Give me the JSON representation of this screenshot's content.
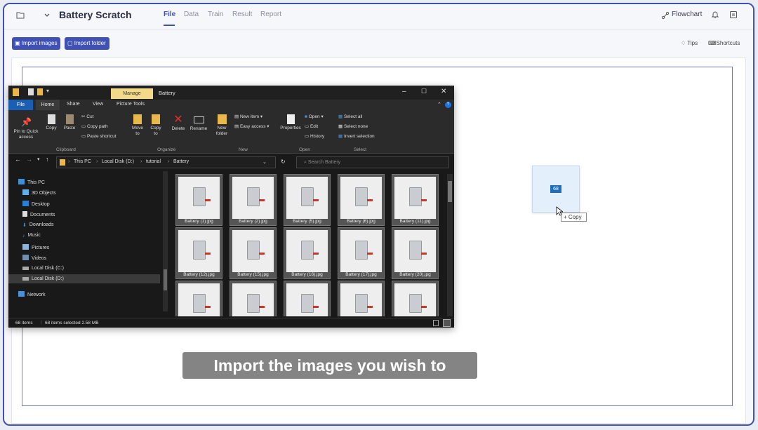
{
  "app": {
    "project_name": "Battery Scratch",
    "tabs": [
      "File",
      "Data",
      "Train",
      "Result",
      "Report"
    ],
    "active_tab": "File",
    "flowchart_label": "Flowchart",
    "import_images_label": "Import images",
    "import_folder_label": "Import folder",
    "tips_label": "Tips",
    "shortcuts_label": "Shortcuts",
    "accent_color": "#3f51b5"
  },
  "explorer": {
    "window_title": "Battery",
    "manage_label": "Manage",
    "tabs": {
      "file": "File",
      "home": "Home",
      "share": "Share",
      "view": "View",
      "picture_tools": "Picture Tools"
    },
    "ribbon": {
      "pin": "Pin to Quick access",
      "copy": "Copy",
      "paste": "Paste",
      "cut": "Cut",
      "copy_path": "Copy path",
      "paste_shortcut": "Paste shortcut",
      "clipboard": "Clipboard",
      "move_to": "Move to",
      "copy_to": "Copy to",
      "delete": "Delete",
      "rename": "Rename",
      "organize": "Organize",
      "new_folder": "New folder",
      "new_item": "New item",
      "easy_access": "Easy access",
      "new_group": "New",
      "properties": "Properties",
      "open": "Open",
      "edit": "Edit",
      "history": "History",
      "open_group": "Open",
      "select_all": "Select all",
      "select_none": "Select none",
      "invert_selection": "Invert selection",
      "select_group": "Select"
    },
    "breadcrumb": [
      "This PC",
      "Local Disk (D:)",
      "tutorial",
      "Battery"
    ],
    "search_placeholder": "Search Battery",
    "nav": [
      "This PC",
      "3D Objects",
      "Desktop",
      "Documents",
      "Downloads",
      "Music",
      "Pictures",
      "Videos",
      "Local Disk (C:)",
      "Local Disk (D:)",
      "Network"
    ],
    "files": [
      "Battery (1).jpg",
      "Battery (2).jpg",
      "Battery (5).jpg",
      "Battery (6).jpg",
      "Battery (11).jpg",
      "Battery (12).jpg",
      "Battery (15).jpg",
      "Battery (16).jpg",
      "Battery (17).jpg",
      "Battery (20).jpg"
    ],
    "status": {
      "items": "68 items",
      "selected": "68 items selected  2.58 MB"
    }
  },
  "drag": {
    "count": "68",
    "copy_label": "+ Copy"
  },
  "caption": "Import the images you wish to analyze"
}
